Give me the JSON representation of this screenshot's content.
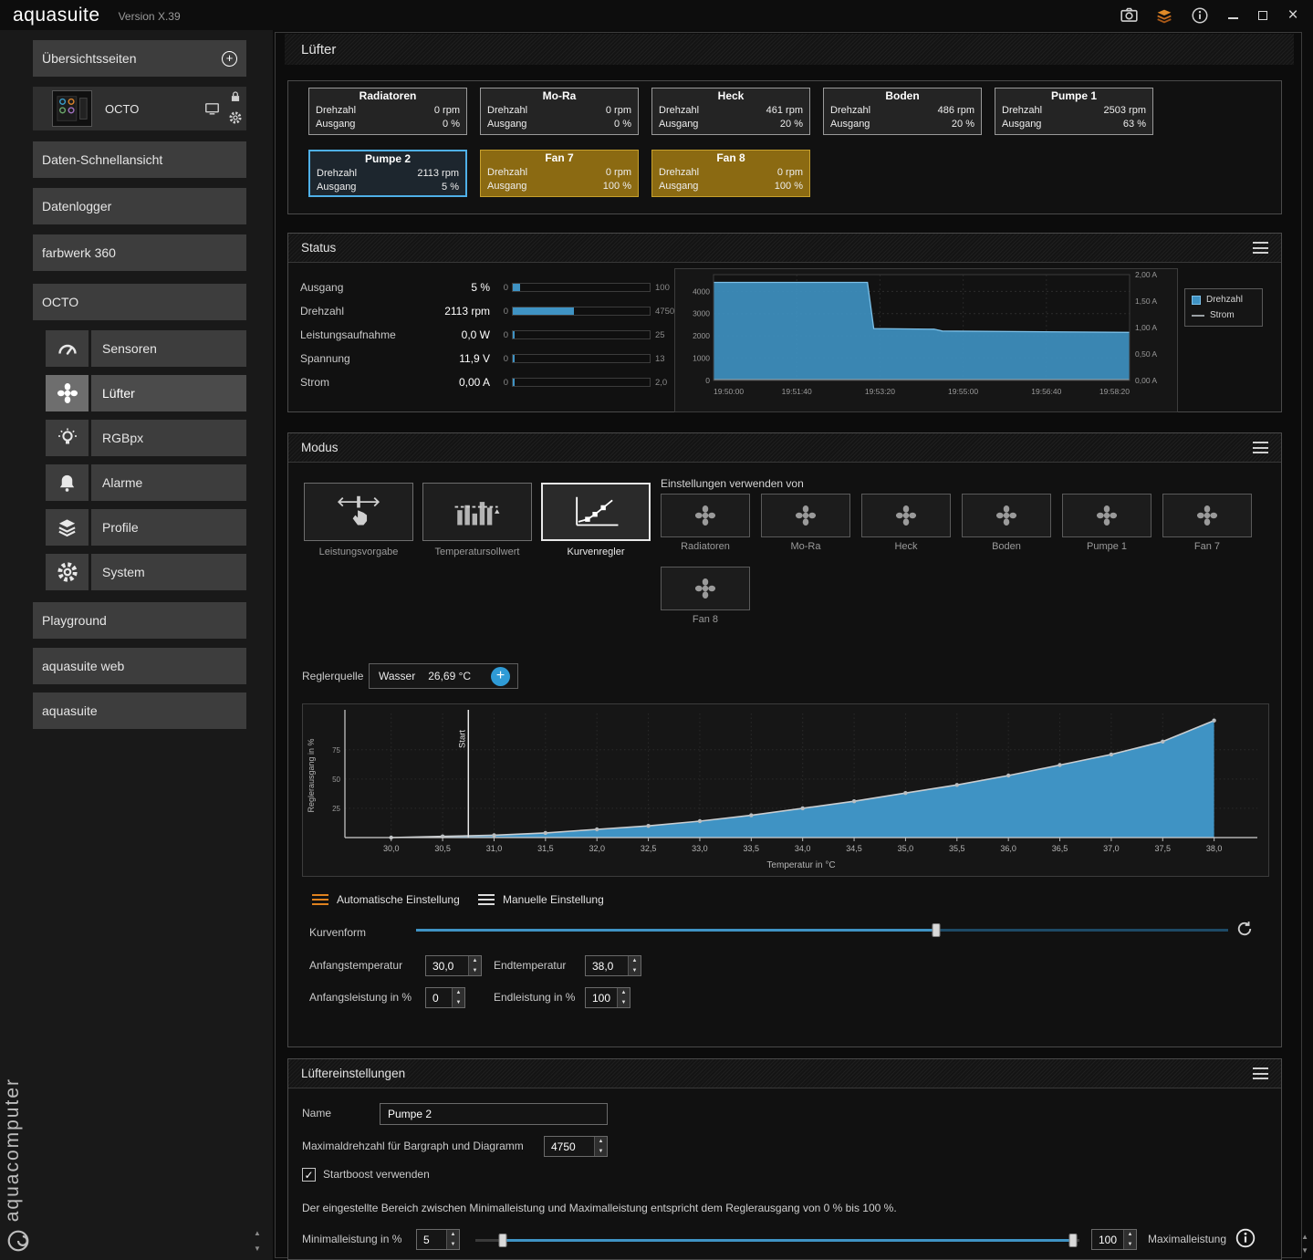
{
  "titlebar": {
    "app_name": "aquasuite",
    "version": "Version X.39"
  },
  "icons": {
    "plus": "+",
    "check": "✓",
    "spin_up": "▲",
    "spin_down": "▼",
    "close": "×",
    "scroll_up": "▲",
    "scroll_down": "▼"
  },
  "sidebar": {
    "overview_header": "Übersichtsseiten",
    "device": {
      "name": "OCTO"
    },
    "nav_items": [
      "Daten-Schnellansicht",
      "Datenlogger",
      "farbwerk 360",
      "OCTO"
    ],
    "octo_subitems": [
      "Sensoren",
      "Lüfter",
      "RGBpx",
      "Alarme",
      "Profile",
      "System"
    ],
    "bottom_items": [
      "Playground",
      "aquasuite web",
      "aquasuite"
    ],
    "brand_vertical": "aquacomputer"
  },
  "page": {
    "title": "Lüfter"
  },
  "fan_tile_labels": {
    "rpm": "Drehzahl",
    "output": "Ausgang"
  },
  "fans": [
    {
      "name": "Radiatoren",
      "rpm": "0 rpm",
      "output": "0 %",
      "state": "normal"
    },
    {
      "name": "Mo-Ra",
      "rpm": "0 rpm",
      "output": "0 %",
      "state": "normal"
    },
    {
      "name": "Heck",
      "rpm": "461 rpm",
      "output": "20 %",
      "state": "normal"
    },
    {
      "name": "Boden",
      "rpm": "486 rpm",
      "output": "20 %",
      "state": "normal"
    },
    {
      "name": "Pumpe 1",
      "rpm": "2503 rpm",
      "output": "63 %",
      "state": "normal"
    },
    {
      "name": "Pumpe 2",
      "rpm": "2113 rpm",
      "output": "5 %",
      "state": "selected"
    },
    {
      "name": "Fan 7",
      "rpm": "0 rpm",
      "output": "100 %",
      "state": "warning"
    },
    {
      "name": "Fan 8",
      "rpm": "0 rpm",
      "output": "100 %",
      "state": "warning"
    }
  ],
  "status": {
    "title": "Status",
    "rows": [
      {
        "label": "Ausgang",
        "value": "5 %",
        "min": "0",
        "max": "100",
        "fraction": 0.05
      },
      {
        "label": "Drehzahl",
        "value": "2113 rpm",
        "min": "0",
        "max": "4750",
        "fraction": 0.445
      },
      {
        "label": "Leistungsaufnahme",
        "value": "0,0 W",
        "min": "0",
        "max": "25",
        "fraction": 0.012
      },
      {
        "label": "Spannung",
        "value": "11,9 V",
        "min": "0",
        "max": "13",
        "fraction": 0.015
      },
      {
        "label": "Strom",
        "value": "0,00 A",
        "min": "0",
        "max": "2,0",
        "fraction": 0.01
      }
    ]
  },
  "modus": {
    "title": "Modus",
    "modes": [
      "Leistungsvorgabe",
      "Temperatursollwert",
      "Kurvenregler"
    ],
    "selected_mode": "Kurvenregler",
    "use_from_label": "Einstellungen verwenden von",
    "use_from": [
      "Radiatoren",
      "Mo-Ra",
      "Heck",
      "Boden",
      "Pumpe 1",
      "Fan 7",
      "Fan 8"
    ],
    "reglerquelle_label": "Reglerquelle",
    "reglerquelle_source": "Wasser",
    "reglerquelle_value": "26,69 °C",
    "auto_label": "Automatische Einstellung",
    "manual_label": "Manuelle Einstellung",
    "kurvenform_label": "Kurvenform",
    "kurvenform_pct": 64,
    "fields": [
      {
        "label": "Anfangstemperatur",
        "value": "30,0"
      },
      {
        "label": "Endtemperatur",
        "value": "38,0"
      },
      {
        "label": "Anfangsleistung in %",
        "value": "0"
      },
      {
        "label": "Endleistung in %",
        "value": "100"
      }
    ]
  },
  "settings": {
    "title": "Lüftereinstellungen",
    "name_label": "Name",
    "name_value": "Pumpe 2",
    "maxrpm_label": "Maximaldrehzahl für Bargraph und Diagramm",
    "maxrpm_value": "4750",
    "startboost_label": "Startboost verwenden",
    "startboost_checked": true,
    "range_text": "Der eingestellte Bereich zwischen Minimalleistung und Maximalleistung entspricht dem Reglerausgang von 0 % bis 100 %.",
    "min_label": "Minimalleistung in %",
    "min_value": "5",
    "max_value": "100",
    "max_label": "Maximalleistung",
    "range_min_pct": 4.5,
    "range_max_pct": 99
  },
  "chart_data": [
    {
      "id": "status-timeseries",
      "type": "area",
      "legend": [
        {
          "label": "Drehzahl",
          "style": "area",
          "color": "#3f93c4"
        },
        {
          "label": "Strom",
          "style": "line",
          "color": "#9aa0a4"
        }
      ],
      "x_ticks": [
        "19:50:00",
        "19:51:40",
        "19:53:20",
        "19:55:00",
        "19:56:40",
        "19:58:20"
      ],
      "y_left_ticks": [
        0,
        1000,
        2000,
        3000,
        4000
      ],
      "y_left_max": 4750,
      "y_right_ticks": [
        "0,00 A",
        "0,50 A",
        "1,00 A",
        "1,50 A",
        "2,00 A"
      ],
      "series": [
        {
          "name": "Drehzahl",
          "points": [
            [
              0,
              4400
            ],
            [
              0.37,
              4400
            ],
            [
              0.385,
              2330
            ],
            [
              0.53,
              2300
            ],
            [
              0.55,
              2220
            ],
            [
              1,
              2160
            ]
          ]
        },
        {
          "name": "Strom",
          "points": [
            [
              0,
              0
            ],
            [
              1,
              0
            ]
          ]
        }
      ]
    },
    {
      "id": "control-curve",
      "type": "area",
      "xlabel": "Temperatur in °C",
      "ylabel": "Reglerausgang in %",
      "xlim": [
        30,
        38
      ],
      "x_step": 0.5,
      "ylim": [
        0,
        100
      ],
      "y_ticks": [
        25,
        50,
        75
      ],
      "start_marker": {
        "x": 30.75,
        "label": "Start"
      },
      "points": [
        [
          30,
          0
        ],
        [
          30.5,
          1
        ],
        [
          31,
          2
        ],
        [
          31.5,
          4
        ],
        [
          32,
          7
        ],
        [
          32.5,
          10
        ],
        [
          33,
          14
        ],
        [
          33.5,
          19
        ],
        [
          34,
          25
        ],
        [
          34.5,
          31
        ],
        [
          35,
          38
        ],
        [
          35.5,
          45
        ],
        [
          36,
          53
        ],
        [
          36.5,
          62
        ],
        [
          37,
          71
        ],
        [
          37.5,
          82
        ],
        [
          38,
          100
        ]
      ],
      "fill_color": "#3f93c4",
      "line_color": "#c9cdd0"
    }
  ]
}
